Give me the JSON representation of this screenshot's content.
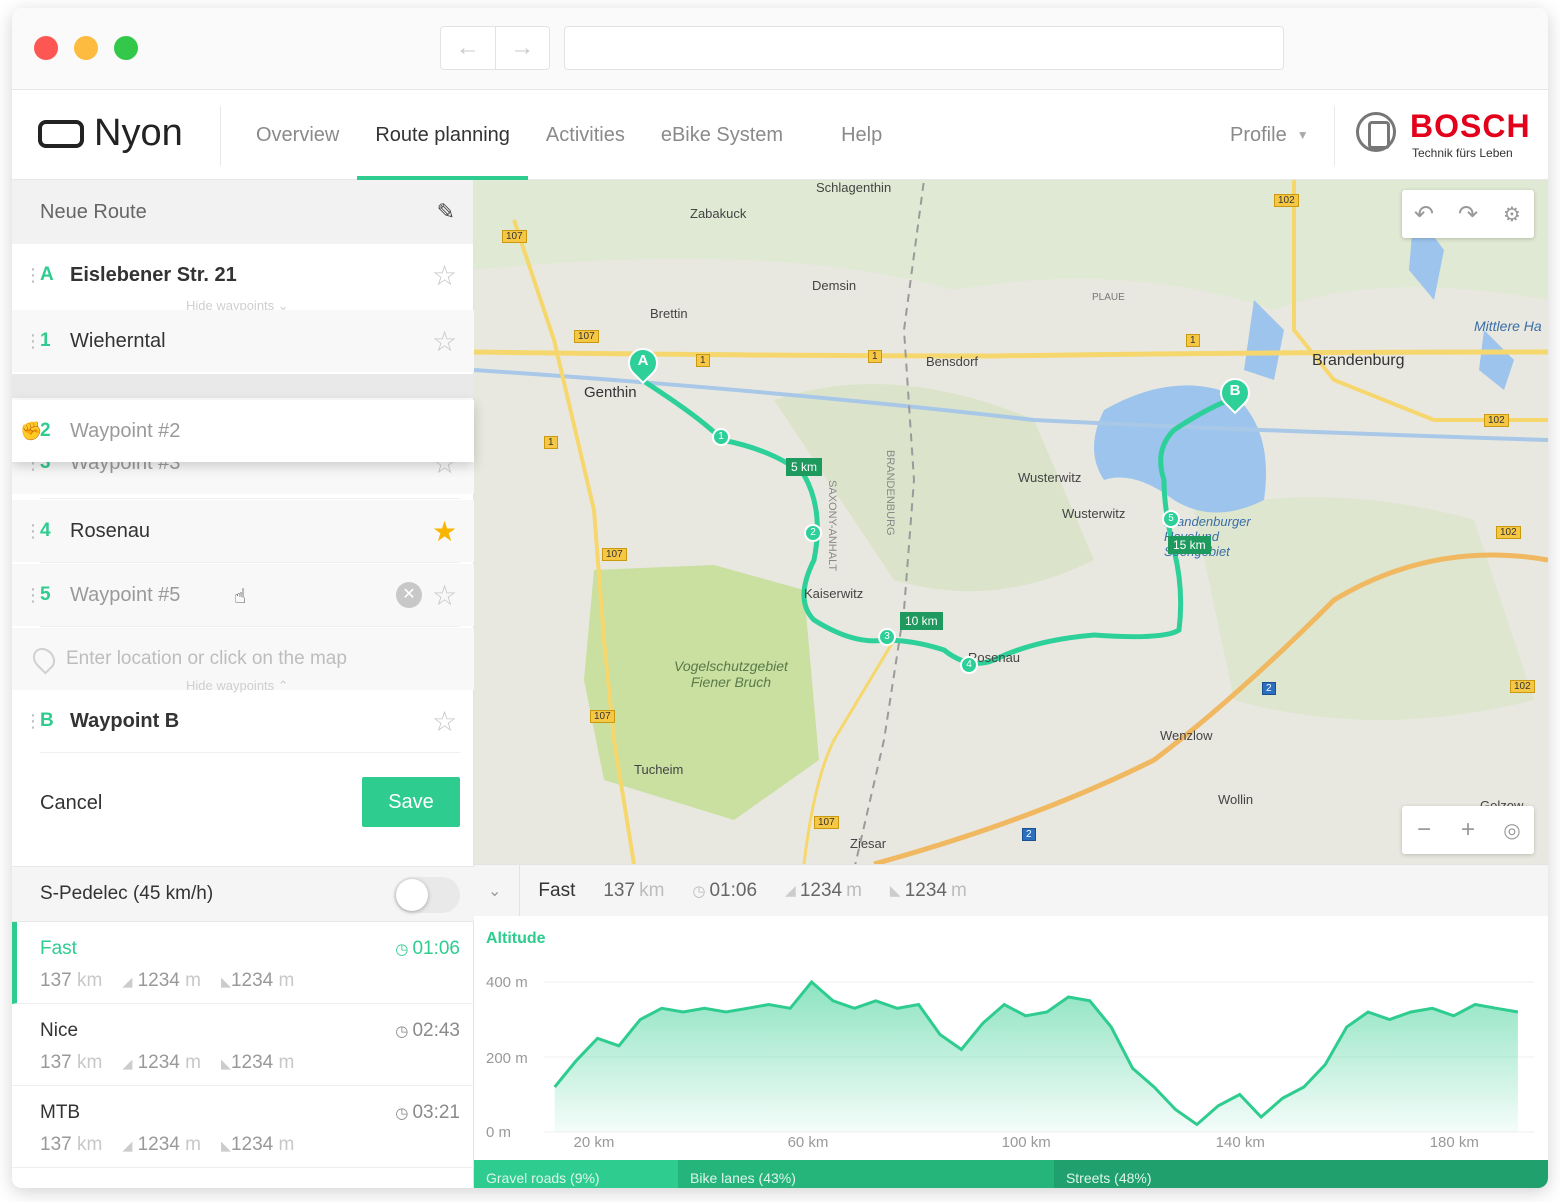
{
  "browser": {
    "back_icon": "arrow-left-icon",
    "forward_icon": "arrow-right-icon",
    "url": ""
  },
  "nav": {
    "brand": "Nyon",
    "links": [
      "Overview",
      "Route planning",
      "Activities",
      "eBike System",
      "Help"
    ],
    "active": "Route planning",
    "profile": "Profile",
    "bosch_name": "BOSCH",
    "bosch_tagline": "Technik fürs Leben"
  },
  "route": {
    "title": "Neue Route",
    "start": {
      "letter": "A",
      "name": "Eislebener Str. 21"
    },
    "hide_waypoints_top": "Hide waypoints ⌄",
    "waypoints": [
      {
        "letter": "1",
        "name": "Wieherntal",
        "starred": false
      },
      {
        "letter": "2",
        "name": "Waypoint #2",
        "starred": false
      },
      {
        "letter": "3",
        "name": "Waypoint #3",
        "starred": false
      },
      {
        "letter": "4",
        "name": "Rosenau",
        "starred": true
      },
      {
        "letter": "5",
        "name": "Waypoint #5",
        "starred": false
      }
    ],
    "enter_placeholder": "Enter location or click on the map",
    "hide_waypoints_bottom": "Hide waypoints ⌃",
    "end": {
      "letter": "B",
      "name": "Waypoint B"
    },
    "cancel": "Cancel",
    "save": "Save"
  },
  "spedelec": {
    "label": "S-Pedelec (45 km/h)",
    "enabled": false
  },
  "profiles": [
    {
      "name": "Fast",
      "time": "01:06",
      "distance": "137",
      "up": "1234",
      "down": "1234",
      "active": true
    },
    {
      "name": "Nice",
      "time": "02:43",
      "distance": "137",
      "up": "1234",
      "down": "1234",
      "active": false
    },
    {
      "name": "MTB",
      "time": "03:21",
      "distance": "137",
      "up": "1234",
      "down": "1234",
      "active": false
    }
  ],
  "units": {
    "km": "km",
    "m": "m"
  },
  "map": {
    "labels": [
      "Schlagenthin",
      "Zabakuck",
      "Demsin",
      "Brettin",
      "Genthin",
      "Bensdorf",
      "PLAUE",
      "Brandenburg",
      "Mittlere Ha",
      "Wusterwitz",
      "Wusterwitz",
      "Kaiserwitz",
      "Rosenau",
      "Wenzlow",
      "Wollin",
      "Golzow",
      "Tucheim",
      "Ziesar",
      "SAXONY-ANHALT",
      "BRANDENBURG"
    ],
    "park": "Vogelschutzgebiet\nFiener Bruch",
    "lake": "Brandenburger\nHavelund\nSeengebiet",
    "km_tags": [
      "5 km",
      "10 km",
      "15 km"
    ],
    "road_numbers": [
      "107",
      "1",
      "102",
      "2"
    ],
    "markers": [
      "A",
      "B",
      "1",
      "2",
      "3",
      "4",
      "5"
    ]
  },
  "summary": {
    "profile": "Fast",
    "distance": "137",
    "time": "01:06",
    "up": "1234",
    "down": "1234"
  },
  "chart_data": {
    "type": "area",
    "title": "Altitude",
    "ylabel": "",
    "yticks": [
      "400 m",
      "200 m",
      "0 m"
    ],
    "xticks": [
      "20 km",
      "60 km",
      "100 km",
      "140 km",
      "180 km"
    ],
    "ylim": [
      0,
      400
    ],
    "xlim": [
      10,
      195
    ],
    "x": [
      12,
      16,
      20,
      24,
      28,
      32,
      36,
      40,
      44,
      48,
      52,
      56,
      60,
      64,
      68,
      72,
      76,
      80,
      84,
      88,
      92,
      96,
      100,
      104,
      108,
      112,
      116,
      120,
      124,
      128,
      132,
      136,
      140,
      144,
      148,
      152,
      156,
      160,
      164,
      168,
      172,
      176,
      180,
      184,
      188,
      192
    ],
    "y": [
      120,
      190,
      250,
      230,
      300,
      330,
      320,
      330,
      320,
      330,
      340,
      330,
      400,
      350,
      330,
      350,
      330,
      340,
      260,
      220,
      290,
      340,
      310,
      320,
      360,
      350,
      280,
      170,
      120,
      60,
      20,
      70,
      100,
      40,
      90,
      120,
      180,
      280,
      320,
      300,
      320,
      330,
      310,
      340,
      330,
      320
    ],
    "grid": true,
    "color": "#2ecc8f"
  },
  "surfaces": [
    {
      "name": "Gravel roads (9%)",
      "share": 0.19,
      "color": "#2ecc8f"
    },
    {
      "name": "Bike lanes (43%)",
      "share": 0.35,
      "color": "#25b57b"
    },
    {
      "name": "Streets (48%)",
      "share": 0.46,
      "color": "#1fa06c"
    }
  ]
}
